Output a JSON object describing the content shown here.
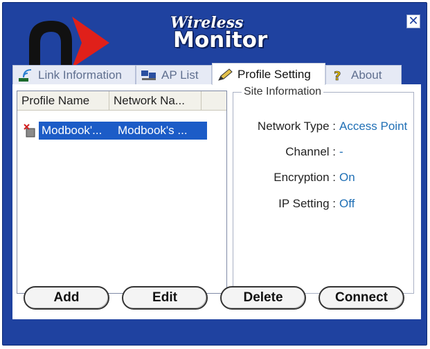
{
  "app": {
    "title_small": "Wireless",
    "title_big": "Monitor",
    "close_symbol": "✕"
  },
  "tabs": [
    {
      "label": "Link Information",
      "icon": "signal-icon"
    },
    {
      "label": "AP List",
      "icon": "computers-icon"
    },
    {
      "label": "Profile Setting",
      "icon": "pencil-icon",
      "active": true
    },
    {
      "label": "About",
      "icon": "question-icon"
    }
  ],
  "profile_list": {
    "columns": [
      "Profile Name",
      "Network Na..."
    ],
    "rows": [
      {
        "profile_name": "Modbook'...",
        "network_name": "Modbook's ..."
      }
    ]
  },
  "site_information": {
    "legend": "Site Information",
    "fields": [
      {
        "key": "Network Type :",
        "value": "Access Point"
      },
      {
        "key": "Channel :",
        "value": "-"
      },
      {
        "key": "Encryption :",
        "value": "On"
      },
      {
        "key": "IP Setting :",
        "value": "Off"
      }
    ]
  },
  "buttons": {
    "add": "Add",
    "edit": "Edit",
    "delete": "Delete",
    "connect": "Connect"
  },
  "colors": {
    "window_bg": "#1f42a0",
    "selection": "#1c5cc7",
    "value_text": "#1f6fb5",
    "logo_red": "#e0201a"
  }
}
